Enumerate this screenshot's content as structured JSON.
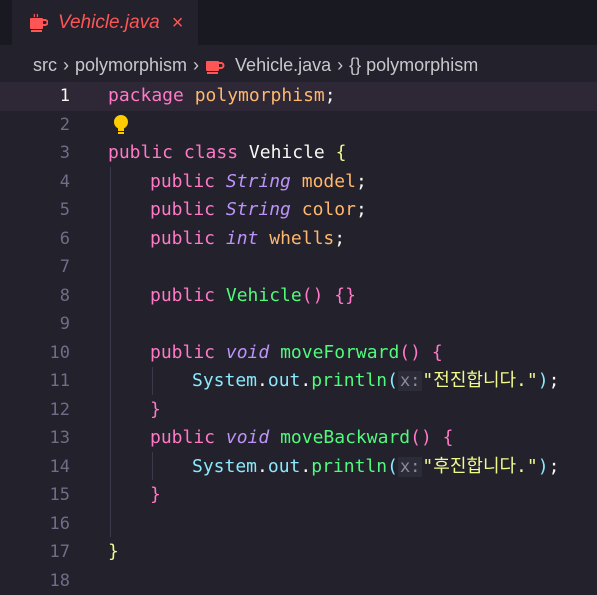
{
  "tab": {
    "label": "Vehicle.java",
    "close": "×"
  },
  "breadcrumb": {
    "items": [
      "src",
      "polymorphism",
      "Vehicle.java",
      "{} polymorphism"
    ]
  },
  "colors": {
    "tab_accent": "#ff5555",
    "background": "#22212c",
    "keyword": "#ff79c6",
    "string": "#f1fa8c"
  },
  "editor": {
    "active_line": 1,
    "lines": [
      {
        "no": "1"
      },
      {
        "no": "2"
      },
      {
        "no": "3"
      },
      {
        "no": "4"
      },
      {
        "no": "5"
      },
      {
        "no": "6"
      },
      {
        "no": "7"
      },
      {
        "no": "8"
      },
      {
        "no": "9"
      },
      {
        "no": "10"
      },
      {
        "no": "11"
      },
      {
        "no": "12"
      },
      {
        "no": "13"
      },
      {
        "no": "14"
      },
      {
        "no": "15"
      },
      {
        "no": "16"
      },
      {
        "no": "17"
      },
      {
        "no": "18"
      }
    ],
    "tokens": {
      "package": "package",
      "pkg_name": "polymorphism",
      "semicolon": ";",
      "public": "public",
      "class": "class",
      "class_name": "Vehicle",
      "string_type": "String",
      "int_type": "int",
      "void": "void",
      "model": "model",
      "color": "color",
      "wheels": "whells",
      "ctor": "Vehicle",
      "move_forward": "moveForward",
      "move_backward": "moveBackward",
      "system": "System",
      "out": "out",
      "println": "println",
      "hint": "x:",
      "forward_str": "\"전진합니다.\"",
      "backward_str": "\"후진합니다.\""
    }
  }
}
